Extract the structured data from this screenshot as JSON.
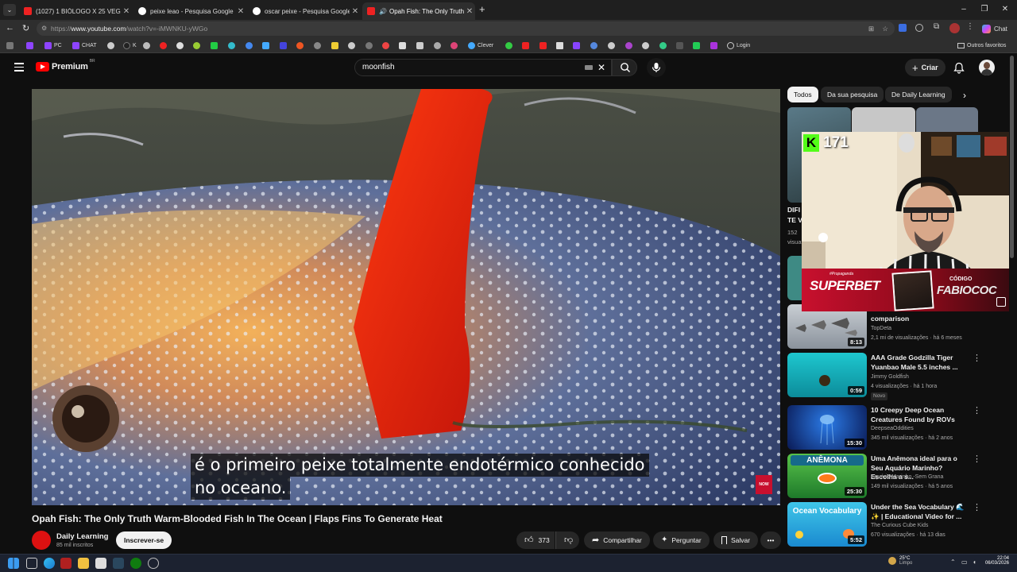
{
  "browser": {
    "tabs": [
      {
        "label": "(1027) 1 BIÓLOGO X 25 VEGANOS",
        "active": false,
        "color": "#e22"
      },
      {
        "label": "peixe leao - Pesquisa Google",
        "active": false,
        "color": "#ffffff"
      },
      {
        "label": "oscar peixe - Pesquisa Google",
        "active": false,
        "color": "#ffffff"
      },
      {
        "label": "Opah Fish: The Only Truth Wa",
        "active": true,
        "color": "#e22"
      }
    ],
    "url_prefix": "https://",
    "url_host": "www.youtube.com",
    "url_path": "/watch?v=-iMWNKU-yWGo",
    "chat_label": "Chat",
    "bookmarks": {
      "pc": "PC",
      "chat": "CHAT",
      "k": "K",
      "clever": "Clever",
      "login": "Login",
      "outros": "Outros favoritos"
    }
  },
  "youtube": {
    "logo_text": "Premium",
    "region": "BR",
    "search_value": "moonfish",
    "create_label": "Criar",
    "accent": "#ff0000"
  },
  "video": {
    "caption_line1": "é o primeiro peixe totalmente endotérmico conhecido",
    "caption_line2": "no oceano.",
    "watermark": "NOW",
    "title": "Opah Fish: The Only Truth Warm-Blooded Fish In The Ocean | Flaps Fins To Generate Heat",
    "channel": "Daily Learning",
    "subs": "85 mil inscritos",
    "subscribe_label": "Inscrever-se",
    "likes": "373",
    "share_label": "Compartilhar",
    "ask_label": "Perguntar",
    "save_label": "Salvar"
  },
  "sidebar": {
    "chips": [
      "Todos",
      "Da sua pesquisa",
      "De Daily Learning"
    ],
    "partial": {
      "line1": "DIFI",
      "line2": "TE V",
      "line3": "152",
      "line4": "visua"
    },
    "recs": [
      {
        "title": "comparison",
        "channel": "TopDeta",
        "meta": "2,1 mi de visualizações · há 6 meses",
        "duration": "8:13",
        "badge": ""
      },
      {
        "title": "AAA Grade Godzilla Tiger Yuanbao Male 5.5 inches ...",
        "channel": "Jimmy Goldfish",
        "meta": "4 visualizações · há 1 hora",
        "duration": "0:59",
        "badge": "Novo"
      },
      {
        "title": "10 Creepy Deep Ocean Creatures Found by ROVs",
        "channel": "DeepseaOddities",
        "meta": "345 mil visualizações · há 2 anos",
        "duration": "15:30",
        "badge": ""
      },
      {
        "title": "Uma Anêmona ideal para o Seu Aquário Marinho? Escolha a s...",
        "channel": "Aquário Marinho -Sem Grana",
        "meta": "149 mil visualizações · há 5 anos",
        "duration": "25:30",
        "badge": "",
        "thumb_text": "ANÊMONA"
      },
      {
        "title": "Under the Sea Vocabulary 🌊 ✨ | Educational Video for ...",
        "channel": "The Curious Cube Kids",
        "meta": "670 visualizações · há 13 dias",
        "duration": "5:52",
        "badge": "",
        "thumb_text": "Ocean Vocabulary"
      }
    ]
  },
  "overlay": {
    "kick_count": "171",
    "sponsor": "SUPERBET",
    "sponsor_tag": "#Propaganda",
    "code_label": "CÓDIGO",
    "code": "FABIOCOC"
  },
  "taskbar": {
    "weather_temp": "25°C",
    "weather_desc": "Limpo",
    "time": "22:04",
    "date": "06/03/2026"
  }
}
